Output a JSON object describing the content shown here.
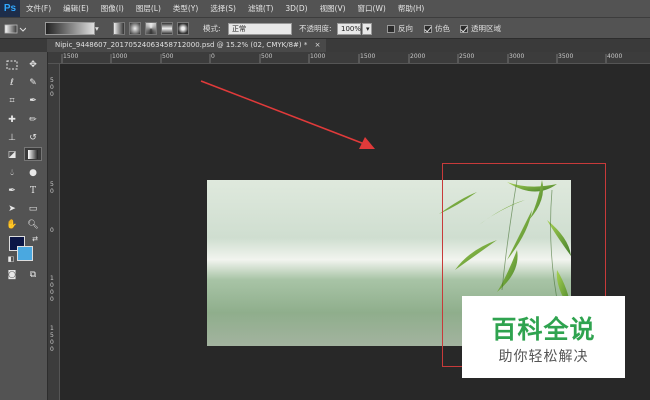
{
  "app": {
    "logo": "Ps"
  },
  "menu": [
    "文件(F)",
    "编辑(E)",
    "图像(I)",
    "图层(L)",
    "类型(Y)",
    "选择(S)",
    "滤镜(T)",
    "3D(D)",
    "视图(V)",
    "窗口(W)",
    "帮助(H)"
  ],
  "options": {
    "mode_label": "模式:",
    "mode_value": "正常",
    "opacity_label": "不透明度:",
    "opacity_value": "100%",
    "reverse_label": "反向",
    "dither_label": "仿色",
    "transparency_label": "透明区域",
    "reverse_checked": false,
    "dither_checked": true,
    "transparency_checked": true
  },
  "document": {
    "tab_title": "Nipic_9448607_20170524063458712000.psd @ 15.2% (02, CMYK/8#) *",
    "close_glyph": "×"
  },
  "ruler": {
    "h_labels": [
      "1500",
      "1000",
      "500",
      "0",
      "500",
      "1000",
      "1500",
      "2000",
      "2500",
      "3000",
      "3500",
      "4000"
    ],
    "v_labels": [
      "5",
      "0",
      "0",
      "5",
      "0",
      "0",
      "1",
      "0",
      "0",
      "0",
      "1",
      "5",
      "0",
      "0"
    ]
  },
  "colors": {
    "foreground": "#0c1646",
    "background": "#4aa8e0",
    "arrow": "#e03a3a",
    "selection": "#c83a3a"
  },
  "watermark": {
    "title": "百科全说",
    "subtitle": "助你轻松解决"
  }
}
